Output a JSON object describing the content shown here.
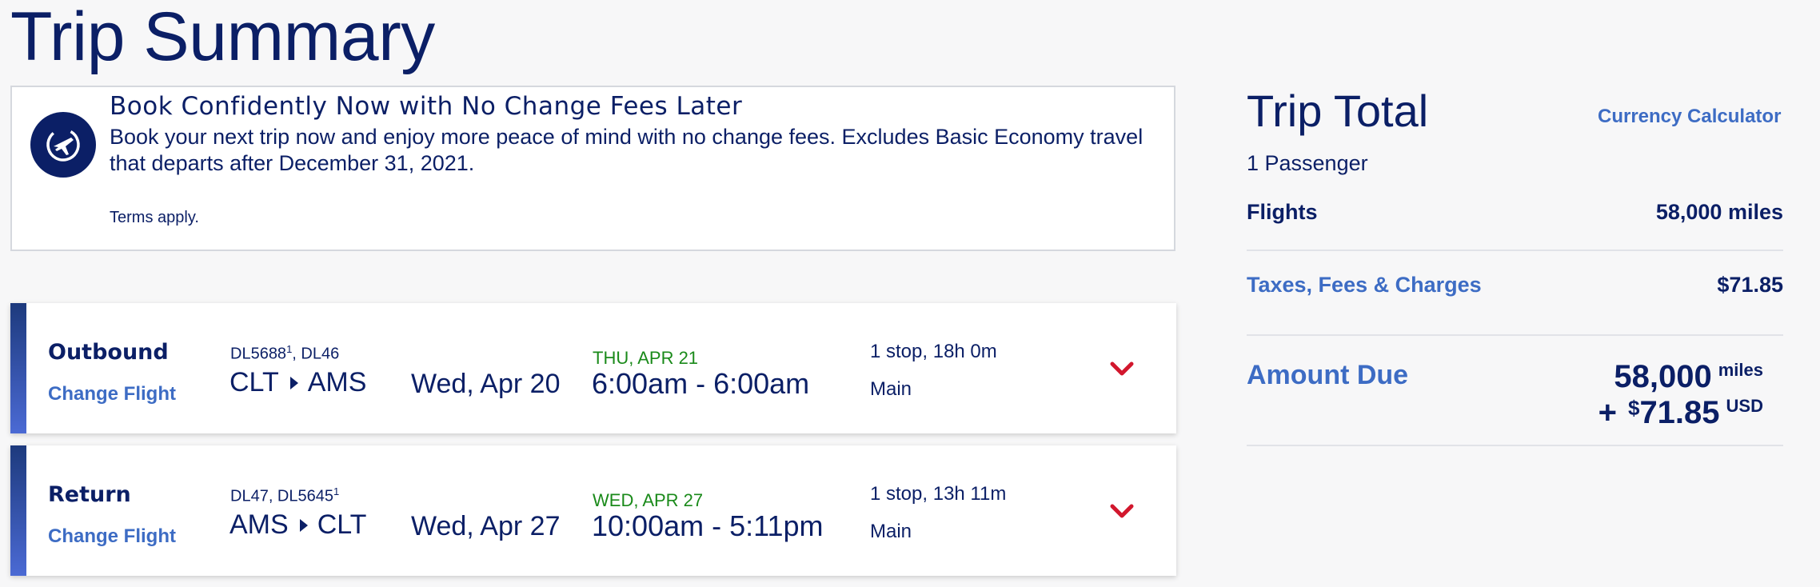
{
  "page": {
    "title": "Trip Summary"
  },
  "promo": {
    "title": "Book Confidently Now with No Change Fees Later",
    "body": "Book your next trip now and enjoy more peace of mind with no change fees. Excludes Basic Economy travel that departs after December 31, 2021.",
    "terms": "Terms apply.",
    "icon": "plane-clock-icon"
  },
  "flights": [
    {
      "type": "Outbound",
      "change_label": "Change Flight",
      "flight_num_1": "DL5688",
      "flight_num_1_sup": "1",
      "flight_num_2": ", DL46",
      "origin": "CLT",
      "destination": "AMS",
      "departure_date": "Wed, Apr 20",
      "arrival_date": "THU, APR 21",
      "times": "6:00am - 6:00am",
      "duration": "1 stop, 18h 0m",
      "cabin": "Main"
    },
    {
      "type": "Return",
      "change_label": "Change Flight",
      "flight_num_1": "DL47, DL5645",
      "flight_num_1_sup": "1",
      "flight_num_2": "",
      "origin": "AMS",
      "destination": "CLT",
      "departure_date": "Wed, Apr 27",
      "arrival_date": "WED, APR 27",
      "times": "10:00am - 5:11pm",
      "duration": "1 stop, 13h 11m",
      "cabin": "Main"
    }
  ],
  "trip_total": {
    "title": "Trip Total",
    "currency_link": "Currency Calculator",
    "passengers": "1 Passenger",
    "flights_label": "Flights",
    "flights_value": "58,000 miles",
    "taxes_label": "Taxes, Fees & Charges",
    "taxes_value": "$71.85",
    "amount_due_label": "Amount Due",
    "amount_miles": "58,000",
    "amount_miles_unit": "miles",
    "amount_plus": "+",
    "amount_dollar_sign": "$",
    "amount_cash": "71.85",
    "amount_cash_unit": "USD"
  },
  "colors": {
    "navy": "#0b1f66",
    "link_blue": "#3d6cc4",
    "green": "#1a8a1a",
    "chevron_red": "#d2172d",
    "accent_bar": "#4b6ad4"
  }
}
